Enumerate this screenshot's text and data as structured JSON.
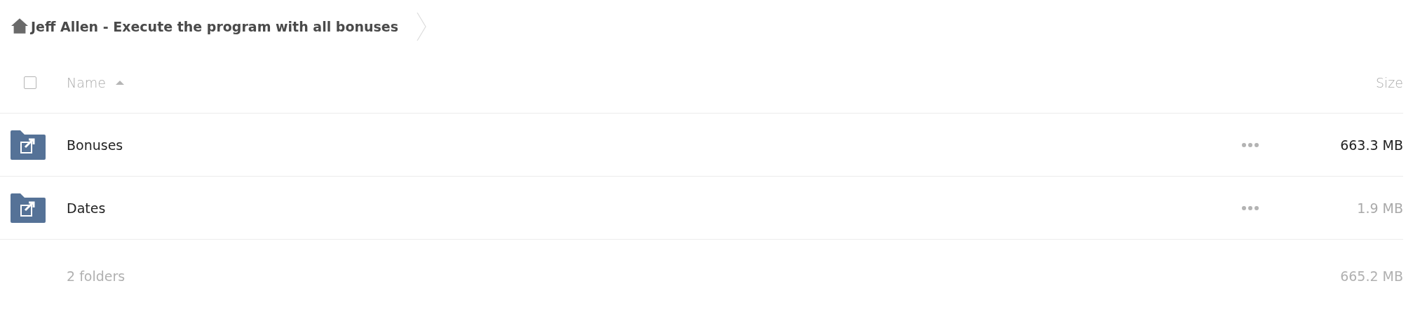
{
  "breadcrumb": {
    "title": "Jeff Allen - Execute the program with all bonuses"
  },
  "table": {
    "select_all": {
      "checked": false
    },
    "columns": [
      {
        "label": "Name",
        "sorted": true
      },
      {
        "label": "Size",
        "sorted": false
      }
    ],
    "rows": [
      {
        "name": "Bonuses",
        "size": "663.3 MB",
        "color": "#222222"
      },
      {
        "name": "Dates",
        "size": "1.9 MB",
        "color": "#a9a9a9"
      }
    ],
    "summary": {
      "count": "2 folders",
      "size": "665.2 MB"
    }
  }
}
